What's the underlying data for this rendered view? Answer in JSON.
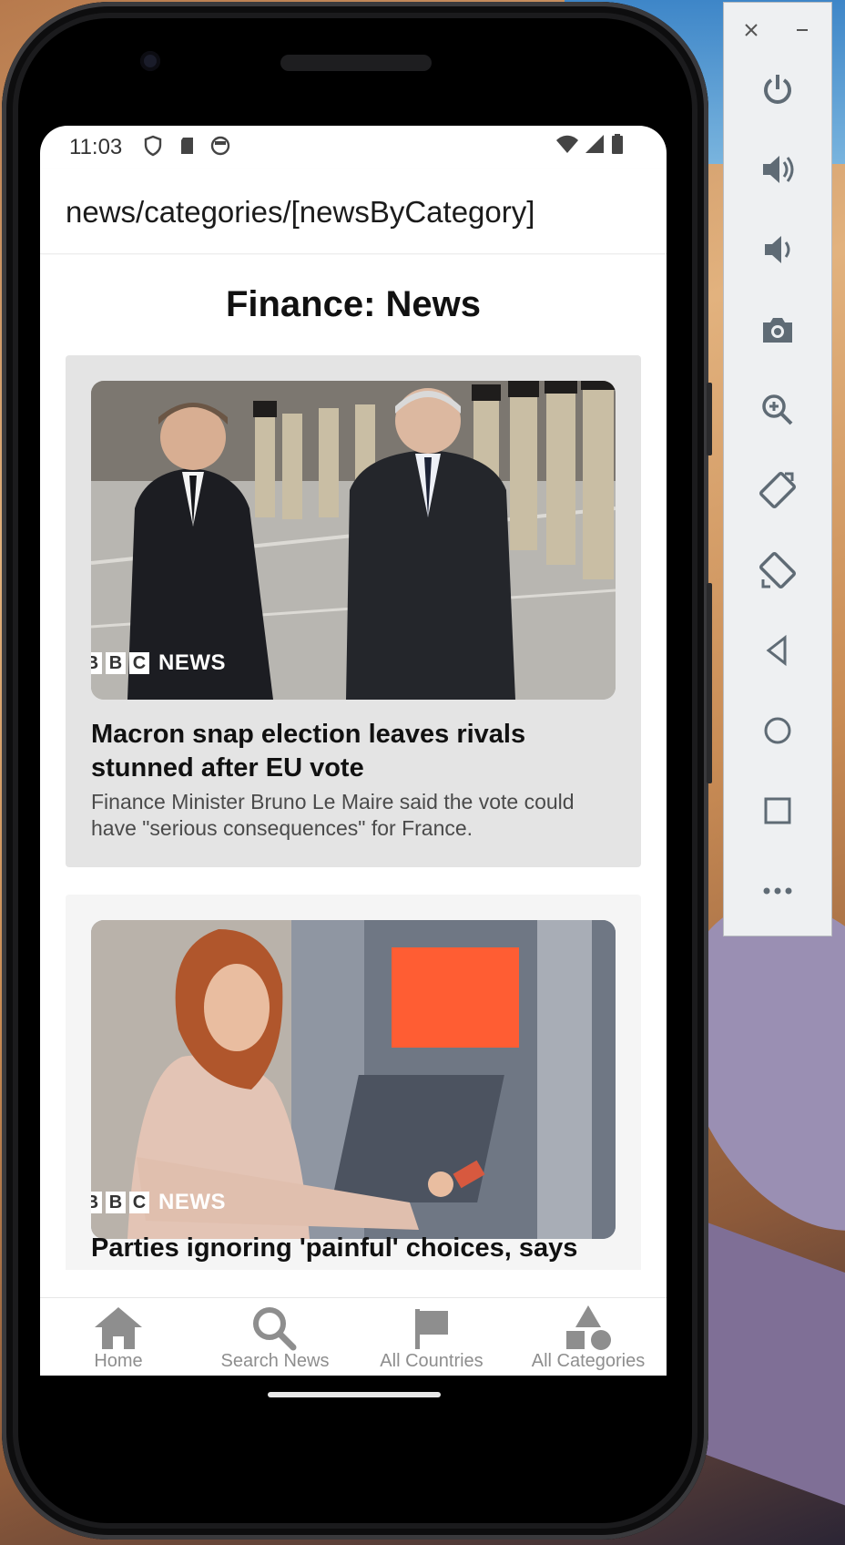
{
  "status_bar": {
    "time": "11:03"
  },
  "app_bar": {
    "title": "news/categories/[newsByCategory]"
  },
  "page": {
    "heading": "Finance: News"
  },
  "articles": [
    {
      "source_badge": "NEWS",
      "title": "Macron snap election leaves rivals stunned after EU vote",
      "description": "Finance Minister Bruno Le Maire said the vote could have \"serious consequences\" for France."
    },
    {
      "source_badge": "NEWS",
      "title": "Parties ignoring 'painful' choices, says",
      "description": ""
    }
  ],
  "bottom_nav": {
    "items": [
      {
        "label": "Home",
        "icon": "home-icon"
      },
      {
        "label": "Search News",
        "icon": "search-icon"
      },
      {
        "label": "All Countries",
        "icon": "flag-icon"
      },
      {
        "label": "All Categories",
        "icon": "shapes-icon"
      }
    ]
  },
  "emulator_controls": {
    "window": [
      "close-icon",
      "minimize-icon"
    ],
    "buttons": [
      "power-icon",
      "volume-up-icon",
      "volume-down-icon",
      "camera-icon",
      "zoom-icon",
      "rotate-left-icon",
      "rotate-right-icon",
      "back-icon",
      "home-circle-icon",
      "overview-icon",
      "more-icon"
    ]
  },
  "colors": {
    "card_active_bg": "#e4e4e4",
    "card_bg": "#f5f5f5",
    "nav_label": "#8e8e8e"
  }
}
